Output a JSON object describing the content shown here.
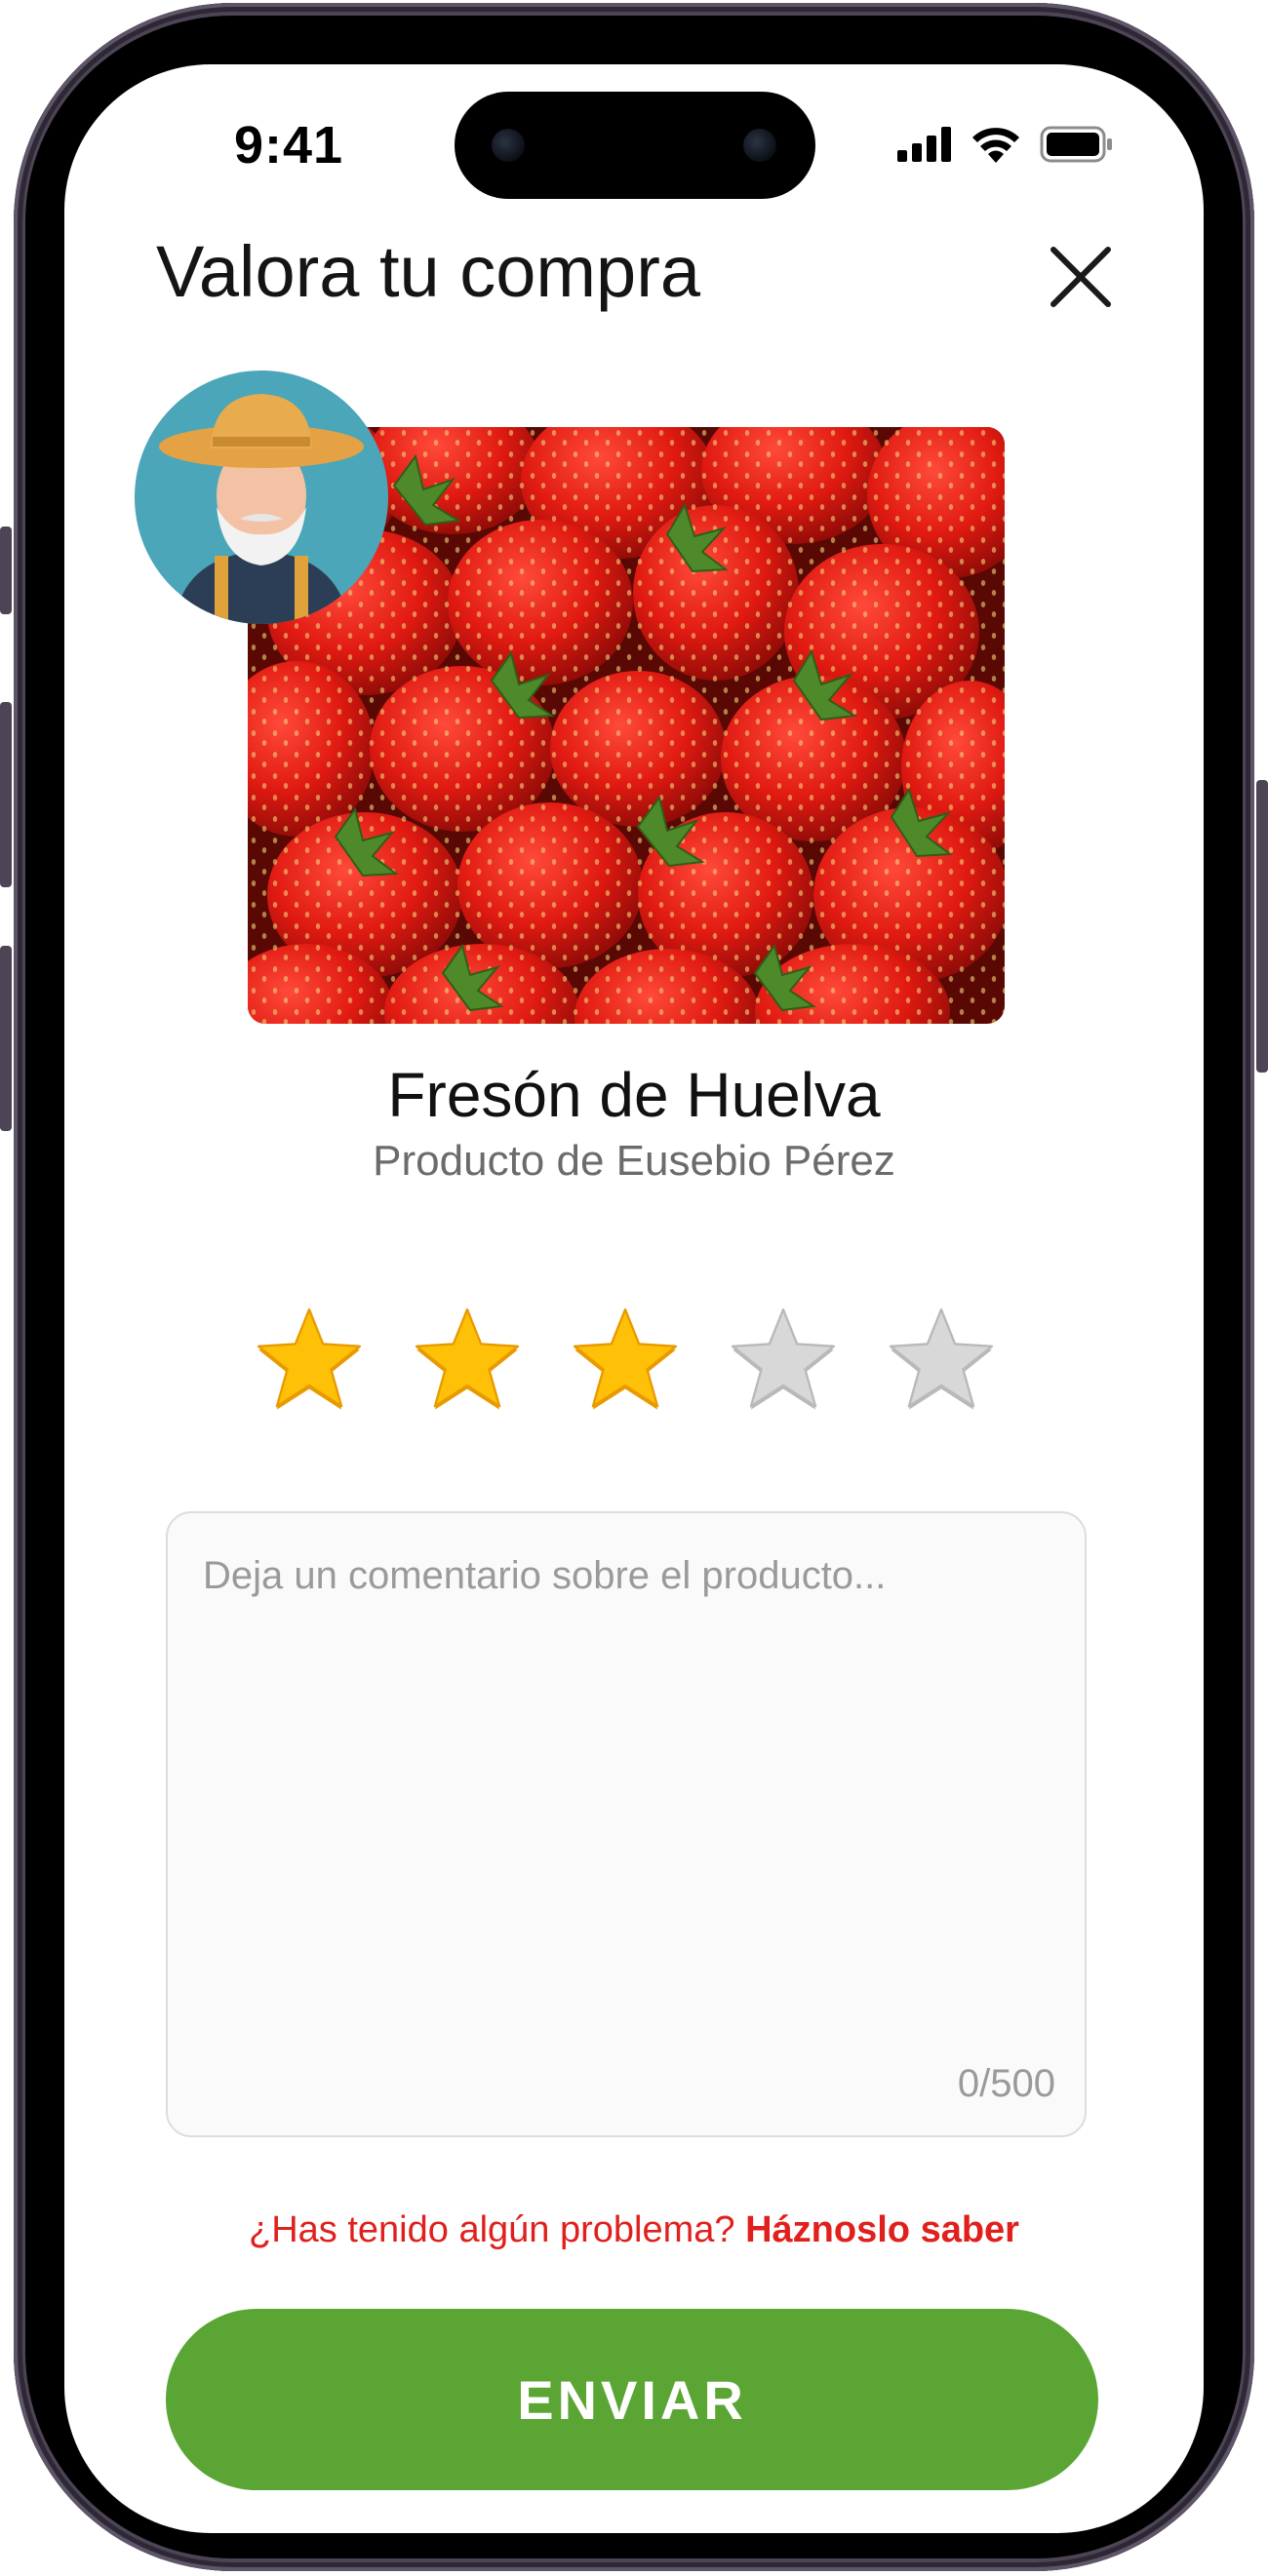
{
  "status_bar": {
    "time": "9:41"
  },
  "header": {
    "title": "Valora tu compra"
  },
  "product": {
    "name": "Fresón de Huelva",
    "producer": "Producto de Eusebio Pérez"
  },
  "rating": {
    "value": 3,
    "max": 5
  },
  "comment": {
    "placeholder": "Deja un comentario sobre el producto...",
    "value": "",
    "counter": "0/500"
  },
  "problem": {
    "question": "¿Has tenido algún problema?",
    "link": "Háznoslo saber"
  },
  "submit": {
    "label": "ENVIAR"
  },
  "colors": {
    "accent_green": "#5aa533",
    "alert_red": "#e0201c",
    "star_active": "#ffc107",
    "star_inactive": "#d8d8d8"
  }
}
